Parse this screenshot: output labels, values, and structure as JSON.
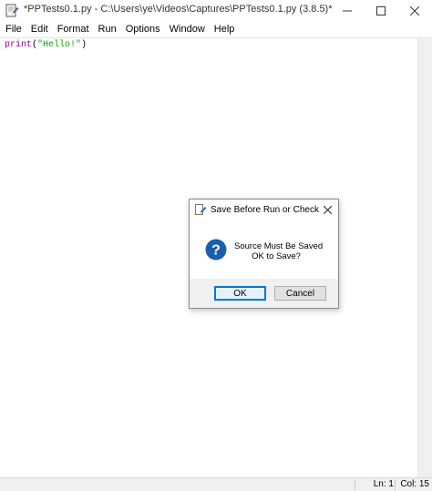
{
  "window": {
    "title": "*PPTests0.1.py - C:\\Users\\ye\\Videos\\Captures\\PPTests0.1.py (3.8.5)*",
    "icon": "python-idle-icon",
    "controls": [
      "minimize-icon",
      "maximize-icon",
      "close-icon"
    ]
  },
  "menu": {
    "items": [
      "File",
      "Edit",
      "Format",
      "Run",
      "Options",
      "Window",
      "Help"
    ]
  },
  "editor": {
    "code": {
      "builtin": "print",
      "open": "(",
      "string": "\"Hello!\"",
      "close": ")"
    },
    "colors": {
      "builtin": "#900090",
      "string": "#00aa00"
    }
  },
  "status": {
    "line": "Ln: 1",
    "col": "Col: 15"
  },
  "dialog": {
    "title": "Save Before Run or Check",
    "message_line1": "Source Must Be Saved",
    "message_line2": "OK to Save?",
    "icon": "question-icon",
    "ok_label": "OK",
    "cancel_label": "Cancel",
    "accent": "#0078d7"
  }
}
